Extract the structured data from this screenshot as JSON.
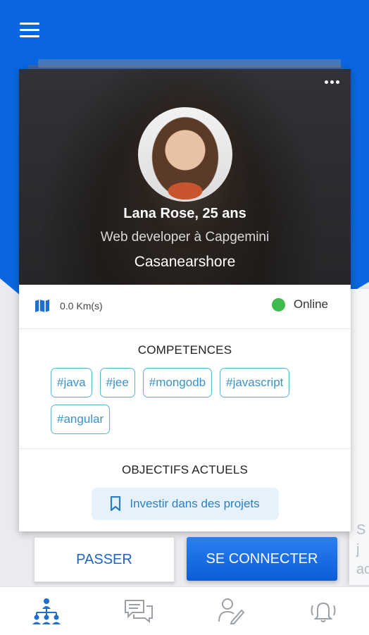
{
  "profile": {
    "name_age": "Lana Rose, 25 ans",
    "job": "Web developer à Capgemini",
    "company": "Casanearshore",
    "distance": "0.0 Km(s)",
    "status": "Online"
  },
  "competences": {
    "title": "COMPETENCES",
    "tags": [
      "#java",
      "#jee",
      "#mongodb",
      "#javascript",
      "#angular"
    ]
  },
  "objectifs": {
    "title": "OBJECTIFS ACTUELS",
    "items": [
      "Investir dans des projets"
    ]
  },
  "actions": {
    "pass_label": "PASSER",
    "connect_label": "SE CONNECTER"
  },
  "peek_card_text": [
    "S",
    "j",
    "ad"
  ],
  "colors": {
    "primary": "#0a66e0",
    "online": "#3dbb4e",
    "tag_border": "#5bb1d6"
  },
  "icons": [
    "menu-icon",
    "more-icon",
    "map-icon",
    "bookmark-icon",
    "network-icon",
    "chat-icon",
    "profile-edit-icon",
    "notification-bell-icon"
  ]
}
